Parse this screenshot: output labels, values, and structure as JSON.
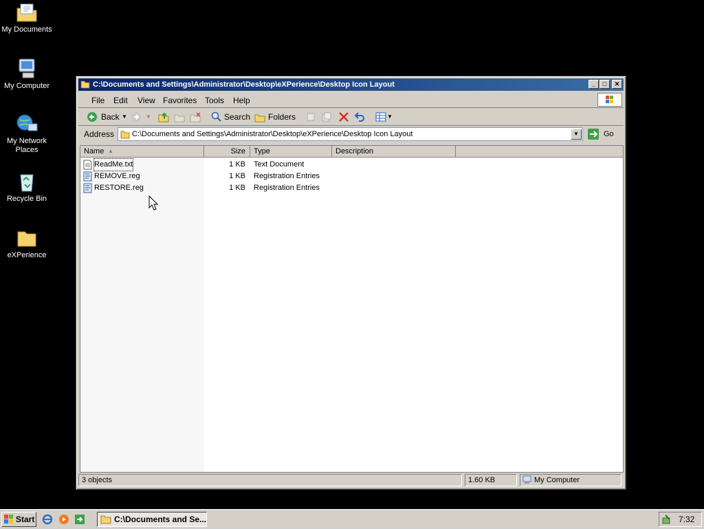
{
  "desktop": {
    "icons": [
      {
        "label": "My Documents"
      },
      {
        "label": "My Computer"
      },
      {
        "label": "My Network Places"
      },
      {
        "label": "Recycle Bin"
      },
      {
        "label": "eXPerience"
      }
    ]
  },
  "window": {
    "title": "C:\\Documents and Settings\\Administrator\\Desktop\\eXPerience\\Desktop Icon Layout",
    "menu": [
      "File",
      "Edit",
      "View",
      "Favorites",
      "Tools",
      "Help"
    ],
    "toolbar": {
      "back": "Back",
      "search": "Search",
      "folders": "Folders"
    },
    "address": {
      "label": "Address",
      "value": "C:\\Documents and Settings\\Administrator\\Desktop\\eXPerience\\Desktop Icon Layout",
      "go": "Go"
    },
    "columns": [
      "Name",
      "Size",
      "Type",
      "Description"
    ],
    "files": [
      {
        "name": "ReadMe.txt",
        "size": "1 KB",
        "type": "Text Document",
        "description": ""
      },
      {
        "name": "REMOVE.reg",
        "size": "1 KB",
        "type": "Registration Entries",
        "description": ""
      },
      {
        "name": "RESTORE.reg",
        "size": "1 KB",
        "type": "Registration Entries",
        "description": ""
      }
    ],
    "status": {
      "objects": "3 objects",
      "size": "1.60 KB",
      "location": "My Computer"
    }
  },
  "taskbar": {
    "start": "Start",
    "task": "C:\\Documents and Se...",
    "clock": "7:32"
  }
}
